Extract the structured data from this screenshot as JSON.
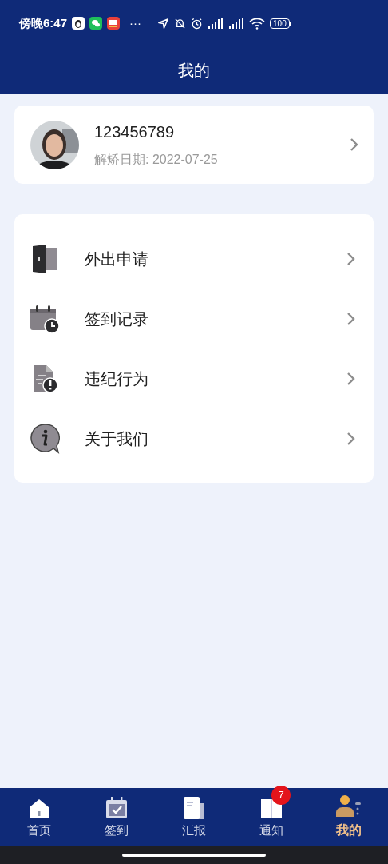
{
  "status_bar": {
    "time": "傍晚6:47",
    "more": "···",
    "battery": "100"
  },
  "header": {
    "title": "我的"
  },
  "profile": {
    "name": "123456789",
    "release_date": "解矫日期: 2022-07-25"
  },
  "menu": [
    {
      "kind": "door",
      "label": "外出申请"
    },
    {
      "kind": "calendar-clock",
      "label": "签到记录"
    },
    {
      "kind": "doc-alert",
      "label": "违纪行为"
    },
    {
      "kind": "info",
      "label": "关于我们"
    }
  ],
  "tab_bar": [
    {
      "kind": "home",
      "label": "首页",
      "selected": false
    },
    {
      "kind": "calendar",
      "label": "签到",
      "selected": false
    },
    {
      "kind": "report",
      "label": "汇报",
      "selected": false
    },
    {
      "kind": "book",
      "label": "通知",
      "selected": false,
      "badge": "7"
    },
    {
      "kind": "person",
      "label": "我的",
      "selected": true
    }
  ]
}
